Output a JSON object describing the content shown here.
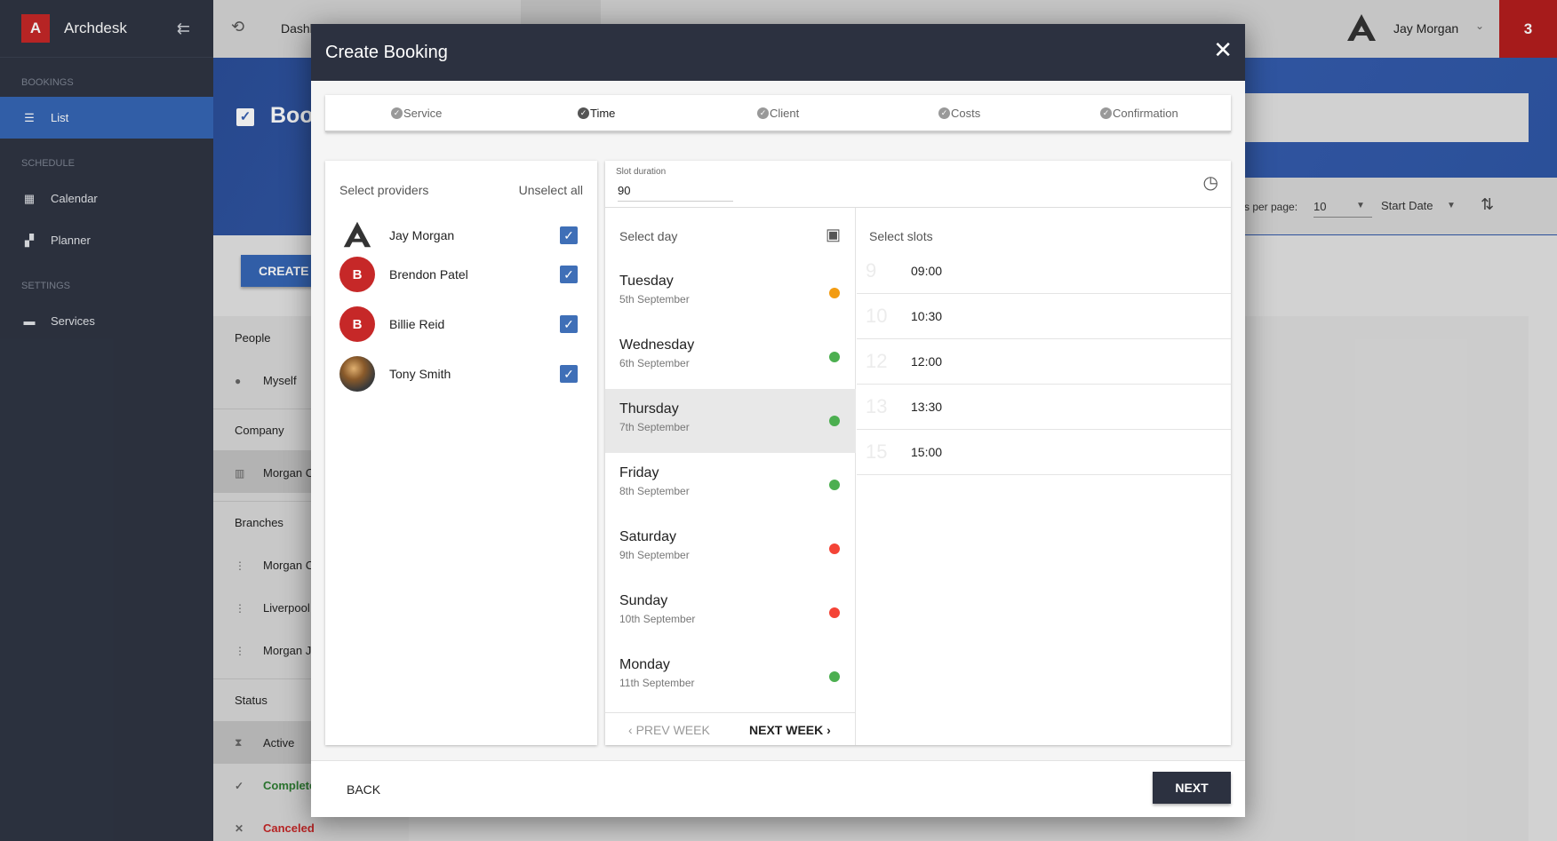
{
  "app": {
    "name": "Archdesk",
    "logo_letter": "A"
  },
  "sidebar": {
    "sections": [
      {
        "label": "BOOKINGS",
        "items": [
          {
            "label": "List",
            "icon": "list-icon",
            "active": true
          }
        ]
      },
      {
        "label": "SCHEDULE",
        "items": [
          {
            "label": "Calendar",
            "icon": "calendar-icon"
          },
          {
            "label": "Planner",
            "icon": "grid-icon"
          }
        ]
      },
      {
        "label": "SETTINGS",
        "items": [
          {
            "label": "Services",
            "icon": "briefcase-icon"
          }
        ]
      }
    ]
  },
  "topbar": {
    "dashboard_label": "Dashb",
    "user_name": "Jay Morgan",
    "notification_count": "3"
  },
  "background": {
    "page_title": "Bool",
    "create_button": "CREATE I",
    "toolbar": {
      "per_page_label": "s per page:",
      "per_page_value": "10",
      "sort_label": "Start Date"
    },
    "filters": {
      "people_label": "People",
      "people_item": "Myself",
      "company_label": "Company",
      "company_item": "Morgan C",
      "branches_label": "Branches",
      "branch_items": [
        "Morgan C",
        "Liverpool",
        "Morgan J"
      ],
      "status_label": "Status",
      "status_items": [
        "Active",
        "Complete",
        "Canceled"
      ]
    }
  },
  "modal": {
    "title": "Create Booking",
    "steps": [
      "Service",
      "Time",
      "Client",
      "Costs",
      "Confirmation"
    ],
    "active_step": "Time",
    "providers": {
      "heading": "Select providers",
      "unselect_all": "Unselect all",
      "list": [
        {
          "name": "Jay Morgan",
          "avatar": "logo",
          "checked": true
        },
        {
          "name": "Brendon Patel",
          "avatar": "B",
          "checked": true
        },
        {
          "name": "Billie Reid",
          "avatar": "B",
          "checked": true
        },
        {
          "name": "Tony Smith",
          "avatar": "photo",
          "checked": true
        }
      ]
    },
    "slot_duration": {
      "label": "Slot duration",
      "value": "90"
    },
    "days": {
      "heading": "Select day",
      "list": [
        {
          "name": "Tuesday",
          "date": "5th September",
          "status_color": "#f39c12"
        },
        {
          "name": "Wednesday",
          "date": "6th September",
          "status_color": "#4caf50"
        },
        {
          "name": "Thursday",
          "date": "7th September",
          "status_color": "#4caf50",
          "selected": true
        },
        {
          "name": "Friday",
          "date": "8th September",
          "status_color": "#4caf50"
        },
        {
          "name": "Saturday",
          "date": "9th September",
          "status_color": "#f44336"
        },
        {
          "name": "Sunday",
          "date": "10th September",
          "status_color": "#f44336"
        },
        {
          "name": "Monday",
          "date": "11th September",
          "status_color": "#4caf50"
        }
      ],
      "prev_week": "PREV WEEK",
      "next_week": "NEXT WEEK"
    },
    "slots": {
      "heading": "Select slots",
      "list": [
        {
          "hour": "9",
          "time": "09:00"
        },
        {
          "hour": "10",
          "time": "10:30"
        },
        {
          "hour": "12",
          "time": "12:00"
        },
        {
          "hour": "13",
          "time": "13:30"
        },
        {
          "hour": "15",
          "time": "15:00"
        }
      ]
    },
    "footer": {
      "back": "BACK",
      "next": "NEXT"
    }
  },
  "colors": {
    "sidebar_bg": "#2f3543",
    "accent": "#3667b6",
    "modal_header": "#2c3140",
    "badge": "#b51e1e"
  }
}
